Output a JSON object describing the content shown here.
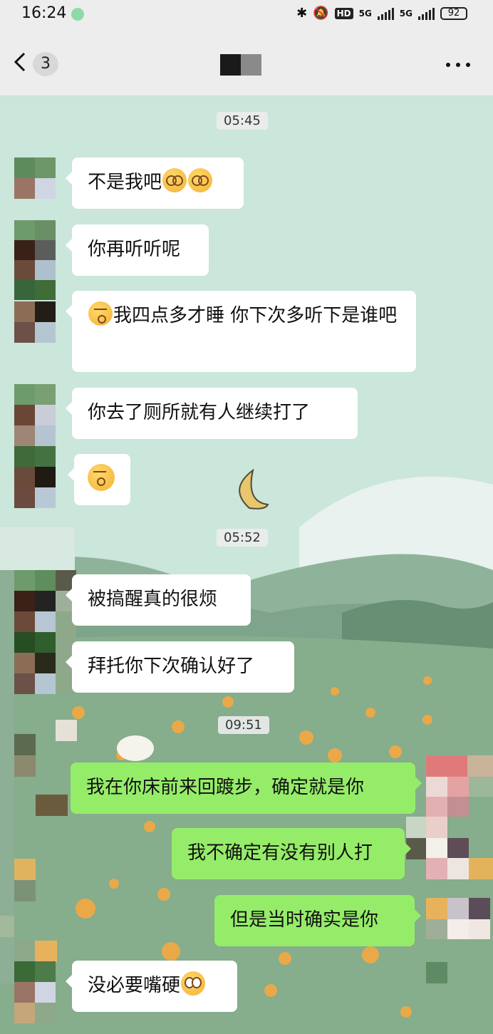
{
  "status_bar": {
    "time": "16:24",
    "signal_1": "5G",
    "signal_2": "5G",
    "battery": "92"
  },
  "nav": {
    "unread_count": "3",
    "back_icon": "chevron-left-icon",
    "more_icon": "more-dots-icon"
  },
  "messages": {
    "ts1": "05:45",
    "m1": "不是我吧",
    "m2": "你再听听呢",
    "m3": "我四点多才睡  你下次多听下是谁吧",
    "m4": "你去了厕所就有人继续打了",
    "ts2": "05:52",
    "m6": "被搞醒真的很烦",
    "m7": "拜托你下次确认好了",
    "ts3": "09:51",
    "o1": "我在你床前来回踱步，确定就是你",
    "o2": "我不确定有没有别人打",
    "o3": "但是当时确实是你",
    "m8": "没必要嘴硬"
  },
  "colors": {
    "incoming_bubble": "#ffffff",
    "outgoing_bubble": "#95ec69",
    "bar": "#ededed"
  }
}
